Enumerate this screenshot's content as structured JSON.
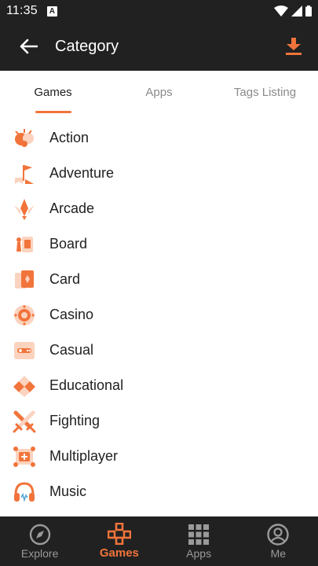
{
  "status": {
    "time": "11:35",
    "notif_letter": "A"
  },
  "app_bar": {
    "title": "Category"
  },
  "tabs": [
    {
      "label": "Games",
      "active": true
    },
    {
      "label": "Apps",
      "active": false
    },
    {
      "label": "Tags Listing",
      "active": false
    }
  ],
  "categories": [
    {
      "label": "Action",
      "icon": "action-icon"
    },
    {
      "label": "Adventure",
      "icon": "adventure-flag-icon"
    },
    {
      "label": "Arcade",
      "icon": "arcade-ship-icon"
    },
    {
      "label": "Board",
      "icon": "board-piece-icon"
    },
    {
      "label": "Card",
      "icon": "card-icon"
    },
    {
      "label": "Casino",
      "icon": "casino-chip-icon"
    },
    {
      "label": "Casual",
      "icon": "casual-controller-icon"
    },
    {
      "label": "Educational",
      "icon": "educational-blocks-icon"
    },
    {
      "label": "Fighting",
      "icon": "crossed-swords-icon"
    },
    {
      "label": "Multiplayer",
      "icon": "multiplayer-icon"
    },
    {
      "label": "Music",
      "icon": "headphones-icon"
    }
  ],
  "bottom_nav": [
    {
      "label": "Explore",
      "icon": "compass-icon",
      "active": false
    },
    {
      "label": "Games",
      "icon": "gamepad-icon",
      "active": true
    },
    {
      "label": "Apps",
      "icon": "apps-grid-icon",
      "active": false
    },
    {
      "label": "Me",
      "icon": "profile-icon",
      "active": false
    }
  ],
  "colors": {
    "accent": "#f1743b",
    "bar": "#212121",
    "accent_light": "#fbd3be"
  }
}
